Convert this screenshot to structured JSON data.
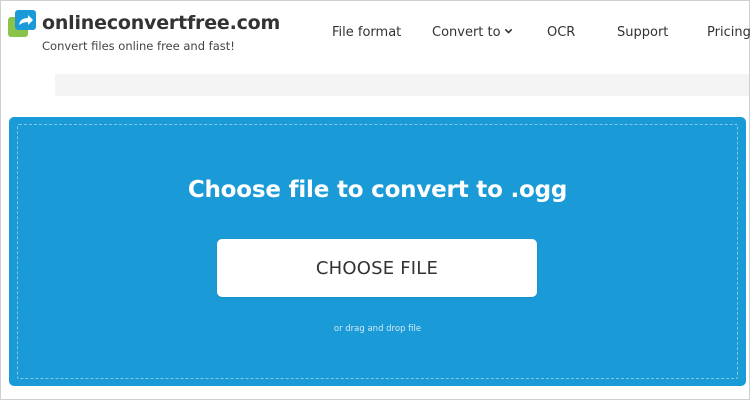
{
  "brand": {
    "name": "onlineconvertfree.com",
    "tagline": "Convert files online free and fast!",
    "logo_icon": "converter-arrow-logo-icon",
    "logo_colors": {
      "blue": "#1a9bd8",
      "green": "#8bc34a"
    }
  },
  "nav": {
    "items": [
      {
        "label": "File format",
        "has_dropdown": false
      },
      {
        "label": "Convert to",
        "has_dropdown": true,
        "icon": "chevron-down-icon"
      },
      {
        "label": "OCR",
        "has_dropdown": false
      },
      {
        "label": "Support",
        "has_dropdown": false
      },
      {
        "label": "Pricing",
        "has_dropdown": false
      }
    ]
  },
  "upload": {
    "title": "Choose file to convert to .ogg",
    "button_label": "CHOOSE FILE",
    "hint": "or drag and drop file"
  },
  "colors": {
    "panel_background": "#1a9bd8",
    "button_background": "#ffffff",
    "text_dark": "#333333"
  }
}
